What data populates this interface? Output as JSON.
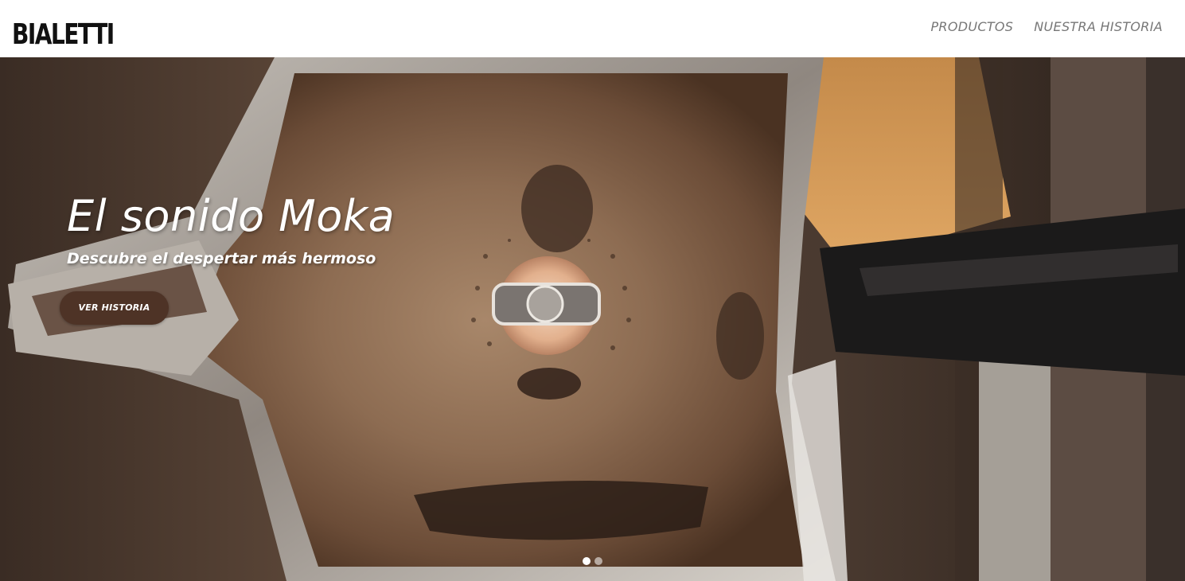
{
  "brand": {
    "name": "BIALETTI",
    "logo_icon": "bialetti-mustache-man-icon"
  },
  "nav": {
    "items": [
      {
        "label": "PRODUCTOS"
      },
      {
        "label": "NUESTRA HISTORIA"
      }
    ]
  },
  "hero": {
    "title": "El sonido Moka",
    "subtitle": "Descubre el despertar más hermoso",
    "button_label": "VER HISTORIA",
    "button_color": "#4e3326",
    "image": "moka-pot-top-view-coffee-photo",
    "slides": 2,
    "active_slide": 1
  }
}
